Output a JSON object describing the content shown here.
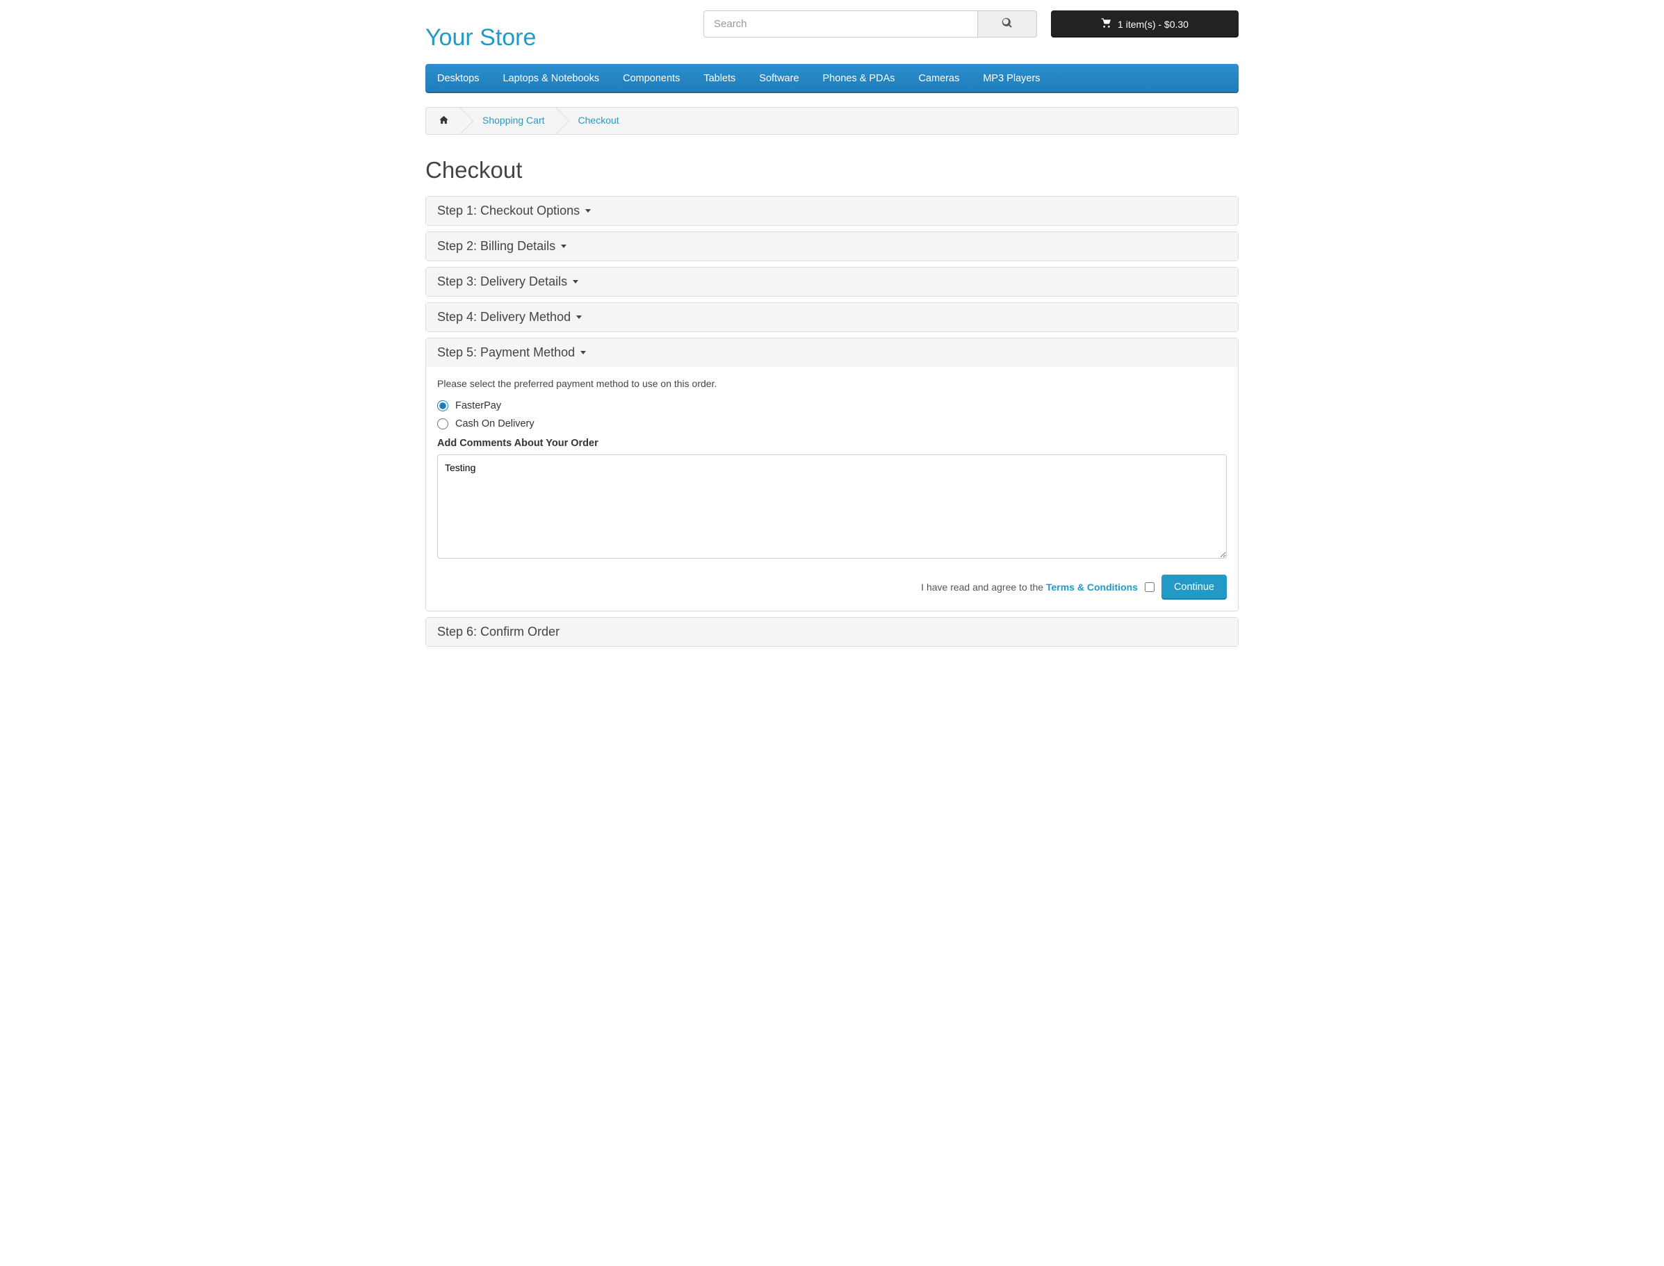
{
  "header": {
    "logo": "Your Store",
    "search_placeholder": "Search",
    "cart_label": "1 item(s) - $0.30"
  },
  "nav": {
    "items": [
      "Desktops",
      "Laptops & Notebooks",
      "Components",
      "Tablets",
      "Software",
      "Phones & PDAs",
      "Cameras",
      "MP3 Players"
    ]
  },
  "breadcrumb": {
    "items": [
      "Shopping Cart",
      "Checkout"
    ]
  },
  "page_title": "Checkout",
  "steps": {
    "s1": "Step 1: Checkout Options",
    "s2": "Step 2: Billing Details",
    "s3": "Step 3: Delivery Details",
    "s4": "Step 4: Delivery Method",
    "s5": "Step 5: Payment Method",
    "s6": "Step 6: Confirm Order"
  },
  "step5": {
    "instruction": "Please select the preferred payment method to use on this order.",
    "option1": "FasterPay",
    "option2": "Cash On Delivery",
    "comments_label": "Add Comments About Your Order",
    "comments_value": "Testing",
    "agree_prefix": "I have read and agree to the ",
    "agree_link": "Terms & Conditions",
    "continue": "Continue"
  }
}
